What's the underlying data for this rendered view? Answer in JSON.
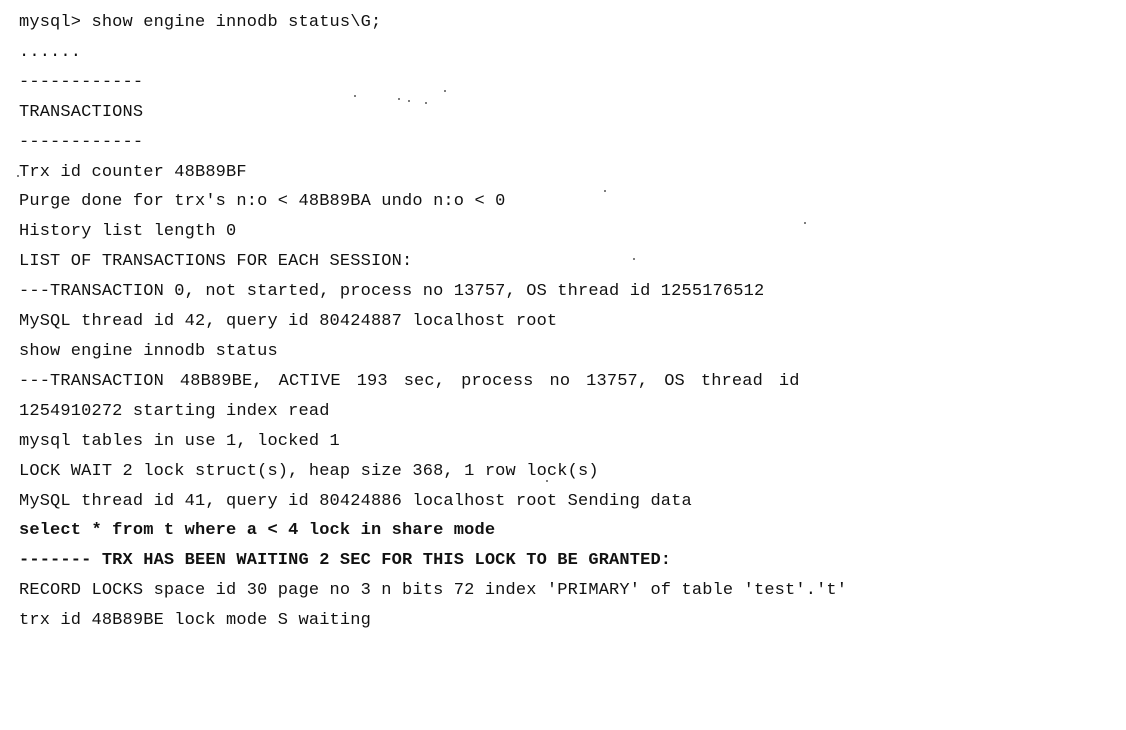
{
  "terminal": {
    "lines": [
      "mysql> show engine innodb status\\G;",
      "......",
      "------------",
      "TRANSACTIONS",
      "------------",
      "Trx id counter 48B89BF",
      "Purge done for trx's n:o < 48B89BA undo n:o < 0",
      "History list length 0",
      "LIST OF TRANSACTIONS FOR EACH SESSION:",
      "---TRANSACTION 0, not started, process no 13757, OS thread id 1255176512",
      "MySQL thread id 42, query id 80424887 localhost root",
      "show engine innodb status",
      "---TRANSACTION 48B89BE, ACTIVE 193 sec, process no 13757, OS thread id",
      "1254910272 starting index read",
      "mysql tables in use 1, locked 1",
      "LOCK WAIT 2 lock struct(s), heap size 368, 1 row lock(s)",
      "MySQL thread id 41, query id 80424886 localhost root Sending data",
      "select * from t where a < 4 lock in share mode",
      "------- TRX HAS BEEN WAITING 2 SEC FOR THIS LOCK TO BE GRANTED:",
      "RECORD LOCKS space id 30 page no 3 n bits 72 index 'PRIMARY' of table 'test'.'t'",
      "trx id 48B89BE lock mode S waiting"
    ]
  }
}
